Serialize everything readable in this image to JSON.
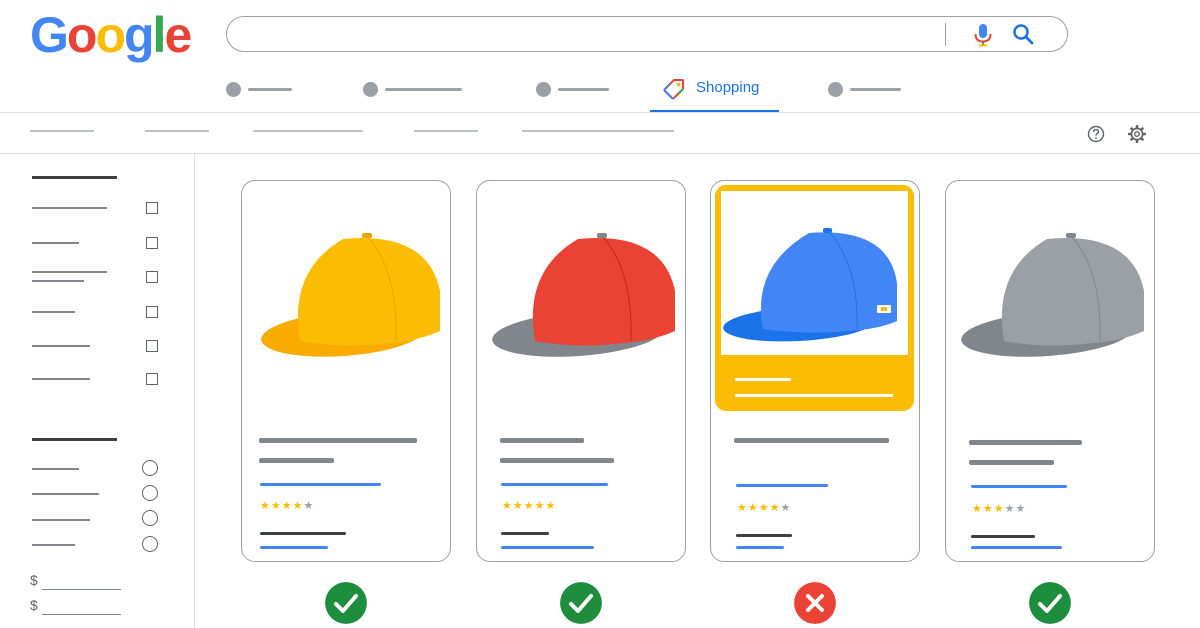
{
  "logo": {
    "letters": [
      "G",
      "o",
      "o",
      "g",
      "l",
      "e"
    ],
    "colors": [
      "#4285F4",
      "#EA4335",
      "#FBBC05",
      "#4285F4",
      "#34A853",
      "#EA4335"
    ]
  },
  "search": {
    "value": "",
    "mic_icon": "microphone-icon",
    "search_icon": "magnifier-icon"
  },
  "tabs": {
    "active_label": "Shopping",
    "active_icon": "shopping-tag-icon"
  },
  "toolbar": {
    "help_icon": "help-circle-icon",
    "settings_icon": "gear-icon"
  },
  "sidebar": {
    "currency_symbols": [
      "$",
      "$"
    ],
    "checkbox_count": 6,
    "radio_count": 4
  },
  "products": [
    {
      "hat_color": "#FBBC04",
      "brim_color": "#F9AB00",
      "rating_stars": 4,
      "max_stars": 5,
      "featured": false,
      "result": "approved"
    },
    {
      "hat_color": "#EA4335",
      "brim_color": "#80868B",
      "rating_stars": 5,
      "max_stars": 5,
      "featured": false,
      "result": "approved"
    },
    {
      "hat_color": "#4285F4",
      "brim_color": "#1A73E8",
      "rating_stars": 4,
      "max_stars": 5,
      "featured": true,
      "result": "rejected"
    },
    {
      "hat_color": "#9AA0A6",
      "brim_color": "#80868B",
      "rating_stars": 3,
      "max_stars": 5,
      "featured": false,
      "result": "approved"
    }
  ],
  "colors": {
    "accent": "#1A73E8",
    "approved": "#1E8E3E",
    "rejected": "#EA4335",
    "highlight": "#FBBC04"
  }
}
